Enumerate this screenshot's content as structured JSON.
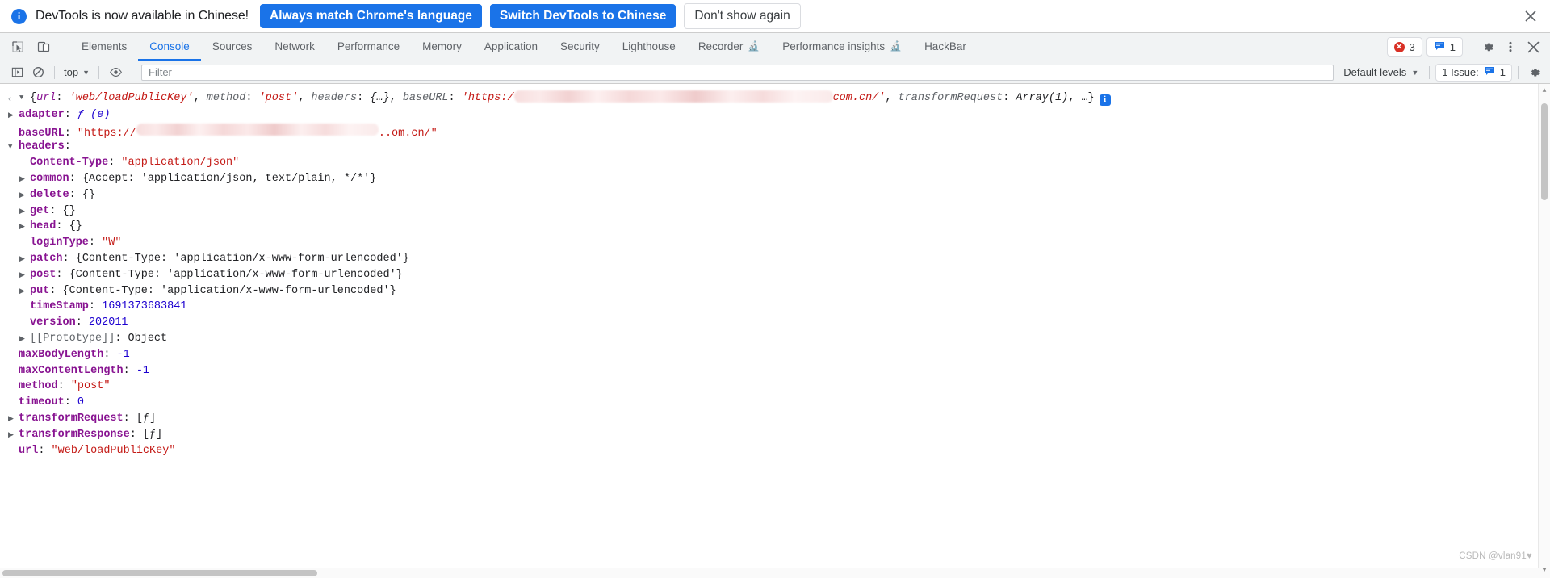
{
  "infobar": {
    "icon": "info-icon",
    "message": "DevTools is now available in Chinese!",
    "primary_button": "Always match Chrome's language",
    "secondary_button": "Switch DevTools to Chinese",
    "dismiss_button": "Don't show again",
    "close_icon": "close-icon",
    "accent_color": "#1a73e8"
  },
  "tabstrip": {
    "inspect_icon": "inspect-element-icon",
    "device_icon": "device-toolbar-icon",
    "tabs": [
      {
        "label": "Elements",
        "selected": false,
        "experimental": false
      },
      {
        "label": "Console",
        "selected": true,
        "experimental": false
      },
      {
        "label": "Sources",
        "selected": false,
        "experimental": false
      },
      {
        "label": "Network",
        "selected": false,
        "experimental": false
      },
      {
        "label": "Performance",
        "selected": false,
        "experimental": false
      },
      {
        "label": "Memory",
        "selected": false,
        "experimental": false
      },
      {
        "label": "Application",
        "selected": false,
        "experimental": false
      },
      {
        "label": "Security",
        "selected": false,
        "experimental": false
      },
      {
        "label": "Lighthouse",
        "selected": false,
        "experimental": false
      },
      {
        "label": "Recorder",
        "selected": false,
        "experimental": true
      },
      {
        "label": "Performance insights",
        "selected": false,
        "experimental": true
      },
      {
        "label": "HackBar",
        "selected": false,
        "experimental": false
      }
    ],
    "error_count": "3",
    "message_count": "1",
    "error_color": "#d93025",
    "message_color": "#1a73e8",
    "settings_icon": "gear-icon",
    "more_icon": "kebab-menu-icon",
    "close_icon": "close-icon"
  },
  "console_toolbar": {
    "sidebar_icon": "console-sidebar-icon",
    "clear_icon": "clear-console-icon",
    "context": "top",
    "context_caret": "chevron-down-icon",
    "eye_icon": "live-expression-icon",
    "filter_placeholder": "Filter",
    "filter_value": "",
    "levels_label": "Default levels",
    "levels_caret": "chevron-down-icon",
    "issues_label": "1 Issue:",
    "issues_count": "1",
    "settings_icon": "gear-icon"
  },
  "console": {
    "header": {
      "nav_arrow": "‹",
      "toggle": "open",
      "segments": [
        {
          "text": "{",
          "cls": "sym"
        },
        {
          "text": "url",
          "cls": "k-plain italic"
        },
        {
          "text": ": ",
          "cls": "sym"
        },
        {
          "text": "'web/loadPublicKey'",
          "cls": "str italic"
        },
        {
          "text": ", ",
          "cls": "sym"
        },
        {
          "text": "method",
          "cls": "dim italic"
        },
        {
          "text": ": ",
          "cls": "sym"
        },
        {
          "text": "'post'",
          "cls": "str italic"
        },
        {
          "text": ", ",
          "cls": "sym"
        },
        {
          "text": "headers",
          "cls": "dim italic"
        },
        {
          "text": ": ",
          "cls": "sym"
        },
        {
          "text": "{…}",
          "cls": "objval italic"
        },
        {
          "text": ", ",
          "cls": "sym"
        },
        {
          "text": "baseURL",
          "cls": "dim italic"
        },
        {
          "text": ": ",
          "cls": "sym"
        },
        {
          "text": "'https:/",
          "cls": "str italic"
        }
      ],
      "redacted_width": 395,
      "segments_after": [
        {
          "text": "com.cn/'",
          "cls": "str italic"
        },
        {
          "text": ", ",
          "cls": "sym"
        },
        {
          "text": "transformRequest",
          "cls": "dim italic"
        },
        {
          "text": ": ",
          "cls": "sym"
        },
        {
          "text": "Array(1)",
          "cls": "objval italic"
        },
        {
          "text": ", …}",
          "cls": "sym"
        }
      ],
      "info_badge": "i"
    },
    "rows": [
      {
        "indent": 0,
        "toggle": "closed",
        "key": "adapter",
        "key_cls": "k",
        "sep": ": ",
        "value": "ƒ (e)",
        "value_cls": "fn"
      },
      {
        "indent": 0,
        "toggle": "none",
        "key": "baseURL",
        "key_cls": "k",
        "sep": ": ",
        "value": "\"https://",
        "value_cls": "str",
        "redact": 300,
        "value_tail": "..om.cn/\"",
        "value_tail_cls": "str"
      },
      {
        "indent": 0,
        "toggle": "open",
        "key": "headers",
        "key_cls": "k",
        "sep": ":",
        "value": "",
        "value_cls": "sym"
      },
      {
        "indent": 1,
        "toggle": "none",
        "key": "Content-Type",
        "key_cls": "k",
        "sep": ": ",
        "value": "\"application/json\"",
        "value_cls": "str"
      },
      {
        "indent": 1,
        "toggle": "closed",
        "key": "common",
        "key_cls": "k",
        "sep": ": ",
        "value": "{Accept: 'application/json, text/plain, */*'}",
        "value_cls": "objval"
      },
      {
        "indent": 1,
        "toggle": "closed",
        "key": "delete",
        "key_cls": "k",
        "sep": ": ",
        "value": "{}",
        "value_cls": "objval"
      },
      {
        "indent": 1,
        "toggle": "closed",
        "key": "get",
        "key_cls": "k",
        "sep": ": ",
        "value": "{}",
        "value_cls": "objval"
      },
      {
        "indent": 1,
        "toggle": "closed",
        "key": "head",
        "key_cls": "k",
        "sep": ": ",
        "value": "{}",
        "value_cls": "objval"
      },
      {
        "indent": 1,
        "toggle": "none",
        "key": "loginType",
        "key_cls": "k",
        "sep": ": ",
        "value": "\"W\"",
        "value_cls": "str"
      },
      {
        "indent": 1,
        "toggle": "closed",
        "key": "patch",
        "key_cls": "k",
        "sep": ": ",
        "value": "{Content-Type: 'application/x-www-form-urlencoded'}",
        "value_cls": "objval"
      },
      {
        "indent": 1,
        "toggle": "closed",
        "key": "post",
        "key_cls": "k",
        "sep": ": ",
        "value": "{Content-Type: 'application/x-www-form-urlencoded'}",
        "value_cls": "objval"
      },
      {
        "indent": 1,
        "toggle": "closed",
        "key": "put",
        "key_cls": "k",
        "sep": ": ",
        "value": "{Content-Type: 'application/x-www-form-urlencoded'}",
        "value_cls": "objval"
      },
      {
        "indent": 1,
        "toggle": "none",
        "key": "timeStamp",
        "key_cls": "k",
        "sep": ": ",
        "value": "1691373683841",
        "value_cls": "num"
      },
      {
        "indent": 1,
        "toggle": "none",
        "key": "version",
        "key_cls": "k",
        "sep": ": ",
        "value": "202011",
        "value_cls": "num"
      },
      {
        "indent": 1,
        "toggle": "closed",
        "key": "[[Prototype]]",
        "key_cls": "k-proto",
        "sep": ": ",
        "value": "Object",
        "value_cls": "objval"
      },
      {
        "indent": 0,
        "toggle": "none",
        "key": "maxBodyLength",
        "key_cls": "k",
        "sep": ": ",
        "value": "-1",
        "value_cls": "num"
      },
      {
        "indent": 0,
        "toggle": "none",
        "key": "maxContentLength",
        "key_cls": "k",
        "sep": ": ",
        "value": "-1",
        "value_cls": "num"
      },
      {
        "indent": 0,
        "toggle": "none",
        "key": "method",
        "key_cls": "k",
        "sep": ": ",
        "value": "\"post\"",
        "value_cls": "str"
      },
      {
        "indent": 0,
        "toggle": "none",
        "key": "timeout",
        "key_cls": "k",
        "sep": ": ",
        "value": "0",
        "value_cls": "num"
      },
      {
        "indent": 0,
        "toggle": "closed",
        "key": "transformRequest",
        "key_cls": "k",
        "sep": ": ",
        "value": "[ƒ]",
        "value_cls": "objval"
      },
      {
        "indent": 0,
        "toggle": "closed",
        "key": "transformResponse",
        "key_cls": "k",
        "sep": ": ",
        "value": "[ƒ]",
        "value_cls": "objval"
      },
      {
        "indent": 0,
        "toggle": "none",
        "key": "url",
        "key_cls": "k",
        "sep": ": ",
        "value": "\"web/loadPublicKey\"",
        "value_cls": "str"
      }
    ]
  },
  "watermark": "CSDN @vlan91♥"
}
